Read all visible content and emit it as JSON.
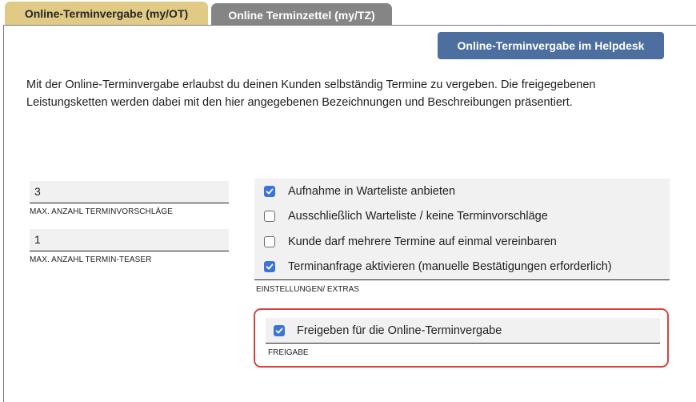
{
  "tabs": [
    {
      "label": "Online-Terminvergabe (my/OT)",
      "active": true
    },
    {
      "label": "Online Terminzettel (my/TZ)",
      "active": false
    }
  ],
  "helpdesk_button": "Online-Terminvergabe im Helpdesk",
  "intro_text": "Mit der Online-Terminvergabe erlaubst du deinen Kunden selbständig Termine zu vergeben. Die freigegebenen Leistungsketten werden dabei mit den hier angegebenen Bezeichnungen und Beschreibungen präsentiert.",
  "fields": [
    {
      "value": "3",
      "label": "MAX. ANZAHL TERMINVORSCHLÄGE"
    },
    {
      "value": "1",
      "label": "MAX. ANZAHL TERMIN-TEASER"
    }
  ],
  "settings": {
    "items": [
      {
        "label": "Aufnahme in Warteliste anbieten",
        "checked": true
      },
      {
        "label": "Ausschließlich Warteliste / keine Terminvorschläge",
        "checked": false
      },
      {
        "label": "Kunde darf mehrere Termine auf einmal vereinbaren",
        "checked": false
      },
      {
        "label": "Terminanfrage aktivieren (manuelle Bestätigungen erforderlich)",
        "checked": true
      }
    ],
    "section_label": "EINSTELLUNGEN/ EXTRAS"
  },
  "freigabe": {
    "label": "Freigeben für die Online-Terminvergabe",
    "checked": true,
    "section_label": "FREIGABE"
  },
  "colors": {
    "active_tab": "#e0ca86",
    "inactive_tab": "#858585",
    "button": "#4d6fa0",
    "checkbox": "#3b73d9",
    "highlight_border": "#d9433f"
  },
  "icons": {
    "checkbox_checked": "checkmark-icon"
  }
}
